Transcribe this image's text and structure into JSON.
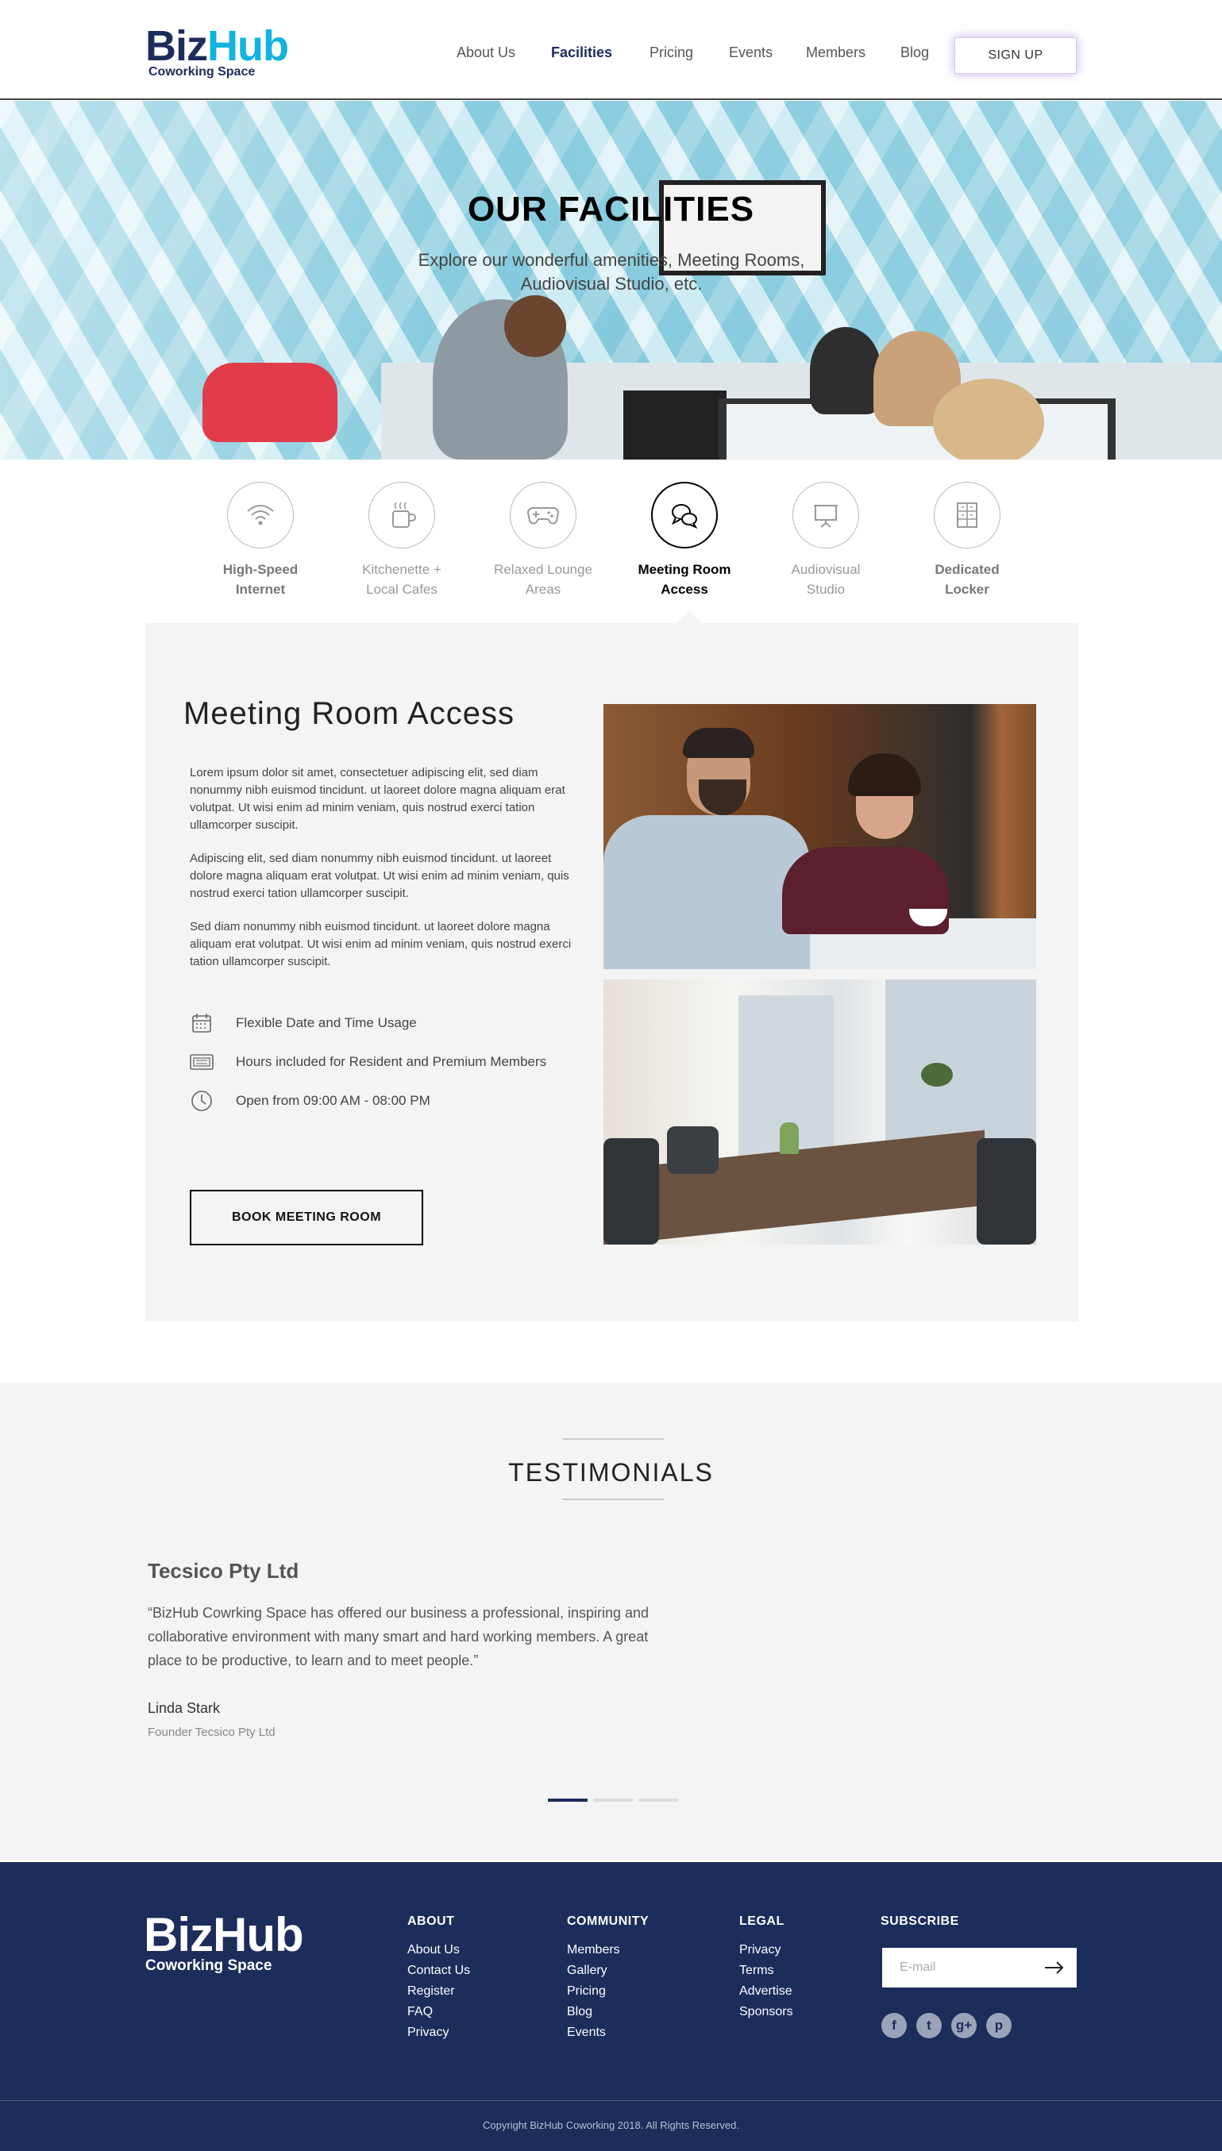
{
  "header": {
    "logo_main_biz": "Biz",
    "logo_main_hub": "Hub",
    "logo_sub": "Coworking Space",
    "nav": [
      "About Us",
      "Facilities",
      "Pricing",
      "Events",
      "Members",
      "Blog"
    ],
    "active_nav": "Facilities",
    "signup_label": "SIGN UP"
  },
  "hero": {
    "title": "OUR FACILITIES",
    "subtitle": "Explore our wonderful amenities, Meeting Rooms, Audiovisual Studio, etc."
  },
  "facilities": {
    "tabs": [
      {
        "line1": "High-Speed",
        "line2": "Internet",
        "icon": "wifi-icon"
      },
      {
        "line1": "Kitchenette +",
        "line2": "Local Cafes",
        "icon": "coffee-cup-icon"
      },
      {
        "line1": "Relaxed Lounge",
        "line2": "Areas",
        "icon": "gamepad-icon"
      },
      {
        "line1": "Meeting Room",
        "line2": "Access",
        "icon": "chat-bubbles-icon"
      },
      {
        "line1": "Audiovisual",
        "line2": "Studio",
        "icon": "presentation-board-icon"
      },
      {
        "line1": "Dedicated",
        "line2": "Locker",
        "icon": "locker-icon"
      }
    ],
    "active_tab": "Meeting Room Access"
  },
  "detail": {
    "title": "Meeting Room Access",
    "paragraphs": [
      "Lorem ipsum dolor sit amet, consectetuer adipiscing elit, sed diam nonummy nibh euismod tincidunt. ut laoreet dolore magna aliquam erat volutpat. Ut wisi enim ad minim veniam, quis nostrud exerci tation ullamcorper suscipit.",
      "Adipiscing elit, sed diam nonummy nibh euismod tincidunt. ut laoreet dolore magna aliquam erat volutpat. Ut wisi enim ad minim veniam, quis nostrud exerci tation ullamcorper suscipit.",
      "Sed diam nonummy nibh euismod tincidunt. ut laoreet dolore magna aliquam erat volutpat. Ut wisi enim ad minim veniam, quis nostrud exerci tation ullamcorper suscipit."
    ],
    "features": [
      {
        "text": "Flexible Date and Time Usage",
        "icon": "calendar-icon"
      },
      {
        "text": "Hours included for Resident and Premium Members",
        "icon": "ticket-icon"
      },
      {
        "text": "Open from 09:00 AM - 08:00 PM",
        "icon": "clock-icon"
      }
    ],
    "book_button": "BOOK MEETING ROOM"
  },
  "testimonials": {
    "title": "TESTIMONIALS",
    "company": "Tecsico Pty Ltd",
    "quote": "“BizHub Cowrking Space has offered our business a professional, inspiring and  collaborative environment with many smart and hard working members. A great place to be productive, to learn and to meet people.”",
    "name": "Linda Stark",
    "role": "Founder Tecsico Pty Ltd",
    "active_slide": 1,
    "slide_count": 3
  },
  "footer": {
    "logo_main": "BizHub",
    "logo_sub": "Coworking Space",
    "about": {
      "heading": "ABOUT",
      "links": [
        "About Us",
        "Contact Us",
        "Register",
        "FAQ",
        "Privacy"
      ]
    },
    "community": {
      "heading": "COMMUNITY",
      "links": [
        "Members",
        "Gallery",
        "Pricing",
        "Blog",
        "Events"
      ]
    },
    "legal": {
      "heading": "LEGAL",
      "links": [
        "Privacy",
        "Terms",
        "Advertise",
        "Sponsors"
      ]
    },
    "subscribe": {
      "heading": "SUBSCRIBE",
      "placeholder": "E-mail"
    },
    "social": [
      {
        "name": "facebook-icon",
        "glyph": "f"
      },
      {
        "name": "twitter-icon",
        "glyph": "t"
      },
      {
        "name": "google-plus-icon",
        "glyph": "g+"
      },
      {
        "name": "pinterest-icon",
        "glyph": "p"
      }
    ],
    "copyright": "Copyright BizHub Coworking 2018. All Rights Reserved."
  },
  "colors": {
    "navy": "#1c2c5b",
    "accent_blue": "#12b3e0",
    "panel_gray": "#f4f4f4",
    "signup_glow": "#966edc"
  }
}
